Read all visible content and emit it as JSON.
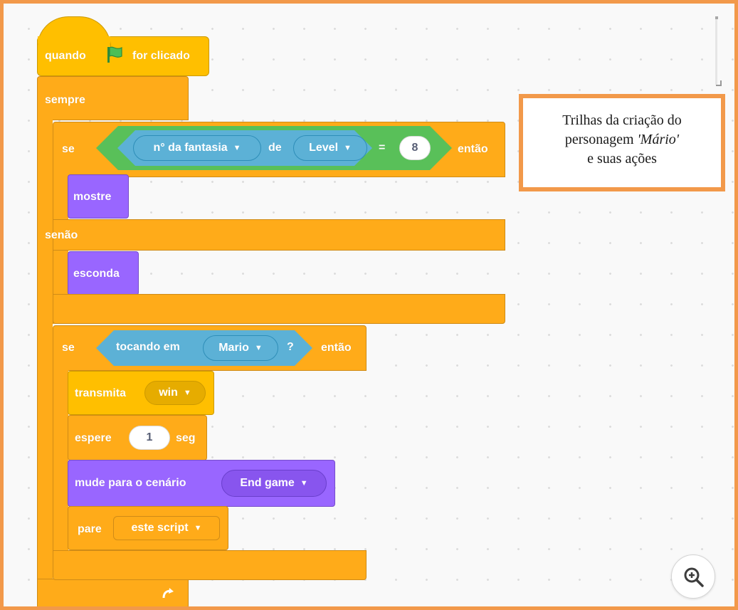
{
  "hat": {
    "quando": "quando",
    "for_clicado": "for clicado"
  },
  "forever": {
    "label": "sempre"
  },
  "if_else_1": {
    "se": "se",
    "sensor_dropdown": "n° da fantasia",
    "de": "de",
    "object_dropdown": "Level",
    "equals": "=",
    "value": "8",
    "entao": "então",
    "show": "mostre",
    "senao": "senão",
    "hide": "esconda"
  },
  "if_2": {
    "se": "se",
    "touching": "tocando em",
    "touch_target": "Mario",
    "question": "?",
    "entao": "então",
    "broadcast": "transmita",
    "broadcast_value": "win",
    "wait": "espere",
    "wait_value": "1",
    "seg": "seg",
    "switch_backdrop": "mude para o cenário",
    "backdrop_value": "End game",
    "stop": "pare",
    "stop_value": "este script"
  },
  "note": {
    "line1": "Trilhas da criação do",
    "line2_prefix": "personagem ",
    "line2_italic": "'Mário'",
    "line3": "e suas ações"
  },
  "icons": {
    "flag": "green-flag-icon",
    "zoom": "zoom-in-icon",
    "dropdown": "dropdown-arrow-icon",
    "loop": "loop-arrow-icon"
  },
  "colors": {
    "control": "#ffab19",
    "events": "#ffbf00",
    "looks": "#9966ff",
    "operators": "#59c059",
    "sensing": "#5cb1d6",
    "frame": "#f2994a"
  }
}
